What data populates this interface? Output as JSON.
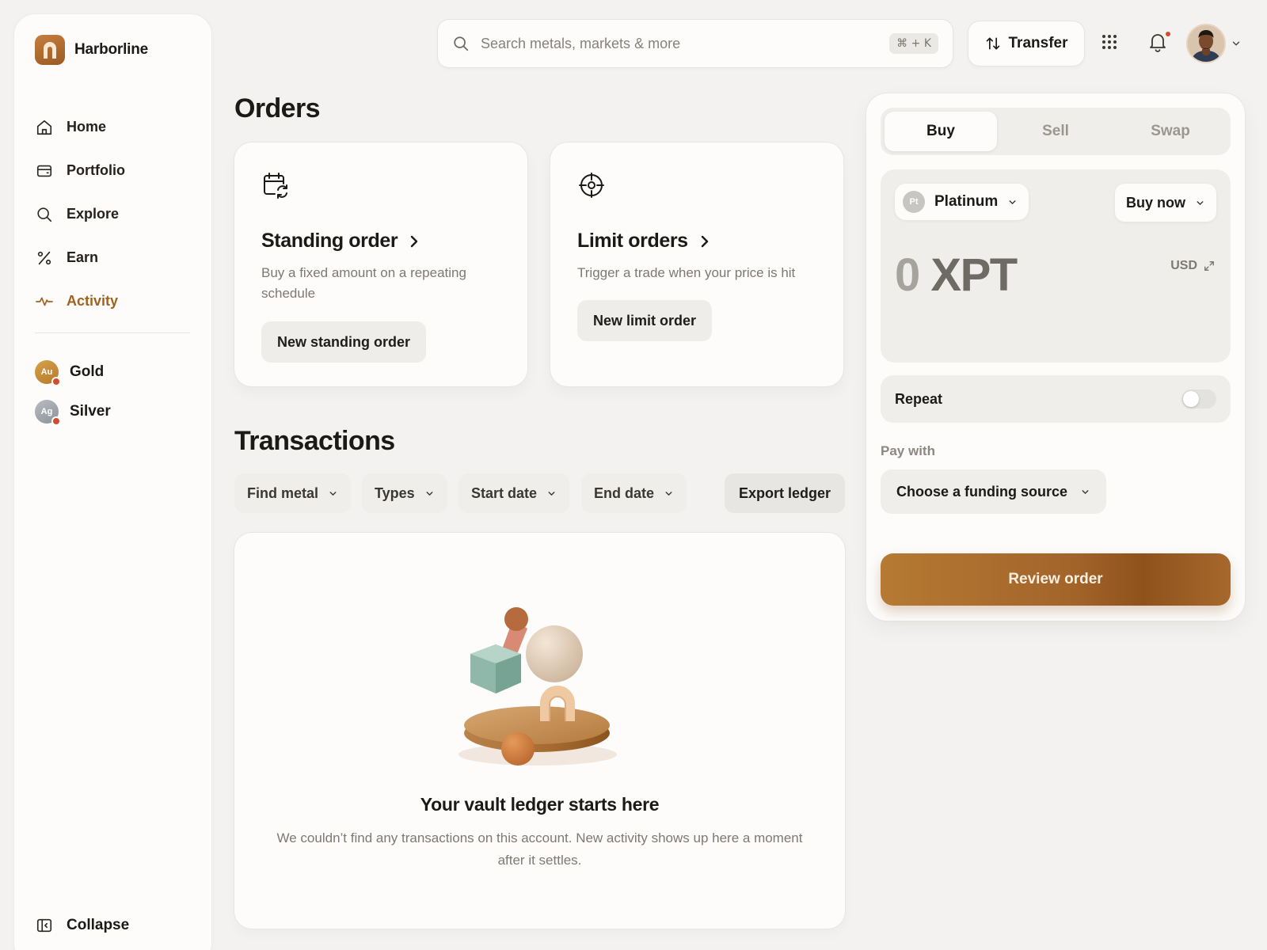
{
  "brand": {
    "name": "Harborline"
  },
  "sidebar": {
    "nav": [
      {
        "label": "Home",
        "icon": "home-icon"
      },
      {
        "label": "Portfolio",
        "icon": "wallet-icon"
      },
      {
        "label": "Explore",
        "icon": "search-icon"
      },
      {
        "label": "Earn",
        "icon": "percent-icon"
      },
      {
        "label": "Activity",
        "icon": "activity-icon",
        "active": true
      }
    ],
    "metals": [
      {
        "symbol": "Au",
        "label": "Gold"
      },
      {
        "symbol": "Ag",
        "label": "Silver"
      }
    ],
    "collapse_label": "Collapse"
  },
  "topbar": {
    "search_placeholder": "Search metals, markets & more",
    "shortcut": "⌘ + K",
    "transfer_label": "Transfer"
  },
  "orders": {
    "title": "Orders",
    "standing": {
      "title": "Standing order",
      "desc": "Buy a fixed amount on a repeating schedule",
      "button": "New standing order"
    },
    "limit": {
      "title": "Limit orders",
      "desc": "Trigger a trade when your price is hit",
      "button": "New limit order"
    }
  },
  "transactions": {
    "title": "Transactions",
    "filters": [
      "Find metal",
      "Types",
      "Start date",
      "End date"
    ],
    "export_label": "Export ledger",
    "empty_title": "Your vault ledger starts here",
    "empty_desc": "We couldn’t find any transactions on this account. New activity shows up here a moment after it settles."
  },
  "trade": {
    "tabs": [
      "Buy",
      "Sell",
      "Swap"
    ],
    "active_tab": "Buy",
    "asset": {
      "symbol": "Pt",
      "name": "Platinum"
    },
    "mode": "Buy now",
    "amount_value": "0",
    "amount_unit": "XPT",
    "currency": "USD",
    "repeat_label": "Repeat",
    "repeat_on": false,
    "pay_with_label": "Pay with",
    "funding_placeholder": "Choose a funding source",
    "review_label": "Review order"
  },
  "colors": {
    "accent": "#a1611f",
    "background": "#f3f2f0",
    "card": "#fdfcfb",
    "notification": "#d24b30"
  }
}
